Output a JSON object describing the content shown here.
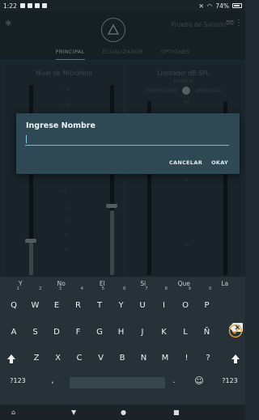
{
  "status_bar": {
    "time": "1:22",
    "battery": "74%"
  },
  "header": {
    "device_name": "Prueba de Sallado",
    "tabs": [
      {
        "label": "PRINCIPAL",
        "active": true
      },
      {
        "label": "ECUALIZADOR",
        "active": false
      },
      {
        "label": "OPTIONES",
        "active": false
      }
    ]
  },
  "mic_panel": {
    "title": "Nivel de Micrófono",
    "scale_labels": [
      "+12",
      "+10",
      "0",
      "-3",
      "-4",
      "-6",
      "-8"
    ]
  },
  "limiter_panel": {
    "title": "Limitador dB-SPL",
    "subtitle": "Umbral",
    "toggle_on": "ENCENDIDO",
    "toggle_off": "APAGADO",
    "scale_labels": [
      "104",
      "90",
      "80"
    ]
  },
  "dialog": {
    "title": "Ingrese Nombre",
    "input_value": "",
    "cancel_label": "CANCELAR",
    "ok_label": "OKAY"
  },
  "keyboard": {
    "suggestions": [
      "Y",
      "No",
      "El",
      "Si",
      "Que",
      "La"
    ],
    "row1": [
      {
        "k": "Q",
        "n": "1"
      },
      {
        "k": "W",
        "n": "2"
      },
      {
        "k": "E",
        "n": "3"
      },
      {
        "k": "R",
        "n": "4"
      },
      {
        "k": "T",
        "n": "5"
      },
      {
        "k": "Y",
        "n": "6"
      },
      {
        "k": "U",
        "n": "7"
      },
      {
        "k": "I",
        "n": "8"
      },
      {
        "k": "O",
        "n": "9"
      },
      {
        "k": "P",
        "n": "0"
      }
    ],
    "row2": [
      "A",
      "S",
      "D",
      "F",
      "G",
      "H",
      "J",
      "K",
      "L",
      "Ñ"
    ],
    "row3": [
      "Z",
      "X",
      "C",
      "V",
      "B",
      "N",
      "M",
      "!",
      "?"
    ],
    "row4": {
      "sym": "?123",
      "comma": ",",
      "period": ".",
      "emoji": "☺",
      "sym_right": "?123"
    }
  },
  "colors": {
    "accent": "#7fb6c6",
    "check_accent": "#e8a232",
    "dialog_bg": "#2e4954"
  }
}
